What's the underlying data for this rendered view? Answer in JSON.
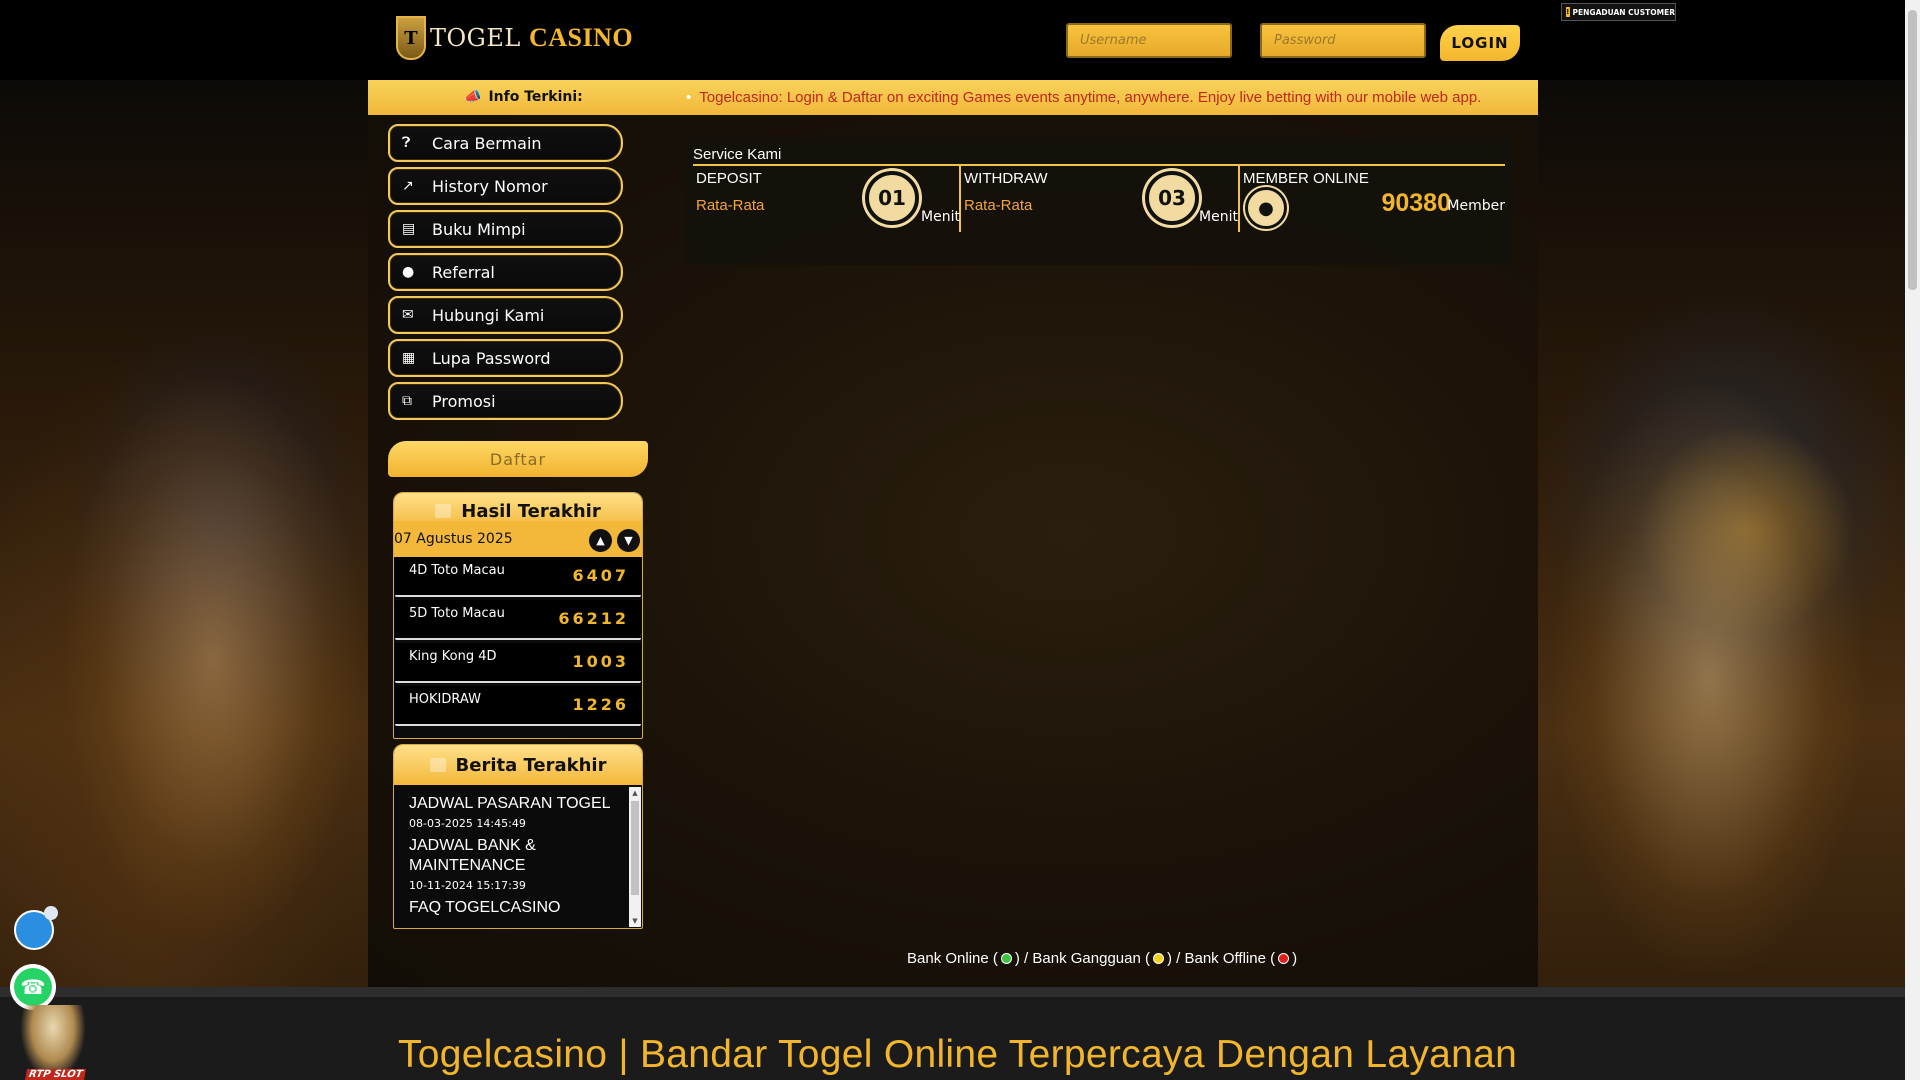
{
  "header": {
    "logo_mark": "T",
    "logo_text_1": "TOGEL",
    "logo_text_2": "CASINO",
    "username_placeholder": "Username",
    "password_placeholder": "Password",
    "login_label": "LOGIN",
    "complaint_label": "PENGADUAN CUSTOMER"
  },
  "ticker": {
    "label": "Info Terkini:",
    "text": "Togelcasino: Login & Daftar on exciting Games events anytime, anywhere. Enjoy live betting with our mobile web app."
  },
  "menu": {
    "items": [
      {
        "label": "Cara Bermain",
        "icon": "question-circle-icon"
      },
      {
        "label": "History Nomor",
        "icon": "line-chart-icon"
      },
      {
        "label": "Buku Mimpi",
        "icon": "newspaper-icon"
      },
      {
        "label": "Referral",
        "icon": "users-icon"
      },
      {
        "label": "Hubungi Kami",
        "icon": "chat-icon"
      },
      {
        "label": "Lupa Password",
        "icon": "calendar-icon"
      },
      {
        "label": "Promosi",
        "icon": "clone-icon"
      }
    ],
    "daftar_label": "Daftar"
  },
  "results": {
    "title": "Hasil Terakhir",
    "date": "07 Agustus 2025",
    "rows": [
      {
        "name": "4D Toto Macau",
        "number": "6407"
      },
      {
        "name": "5D Toto Macau",
        "number": "66212"
      },
      {
        "name": "King Kong 4D",
        "number": "1003"
      },
      {
        "name": "HOKIDRAW",
        "number": "1226"
      }
    ]
  },
  "news": {
    "title": "Berita Terakhir",
    "items": [
      {
        "title": "JADWAL PASARAN TOGEL",
        "date": "08-03-2025 14:45:49"
      },
      {
        "title": "JADWAL BANK & MAINTENANCE",
        "date": "10-11-2024 15:17:39"
      },
      {
        "title": "FAQ TOGELCASINO",
        "date": ""
      }
    ]
  },
  "service": {
    "title": "Service Kami",
    "deposit_label": "DEPOSIT",
    "deposit_sub": "Rata-Rata",
    "deposit_minutes": "01",
    "withdraw_label": "WITHDRAW",
    "withdraw_sub": "Rata-Rata",
    "withdraw_minutes": "03",
    "minutes_word": "Menit",
    "member_label": "MEMBER ONLINE",
    "member_count": "90380",
    "member_word": "Member"
  },
  "bank_legend": {
    "online": "Bank Online (",
    "sep1": ") / Bank Gangguan (",
    "sep2": ") / Bank Offline (",
    "end": ")",
    "colors": {
      "online": "#3cc43c",
      "gangguan": "#f2d21c",
      "offline": "#e01c1c"
    }
  },
  "footer": {
    "title": "Togelcasino | Bandar Togel Online Terpercaya Dengan Layanan"
  },
  "floating": {
    "rtp_label": "RTP SLOT"
  }
}
